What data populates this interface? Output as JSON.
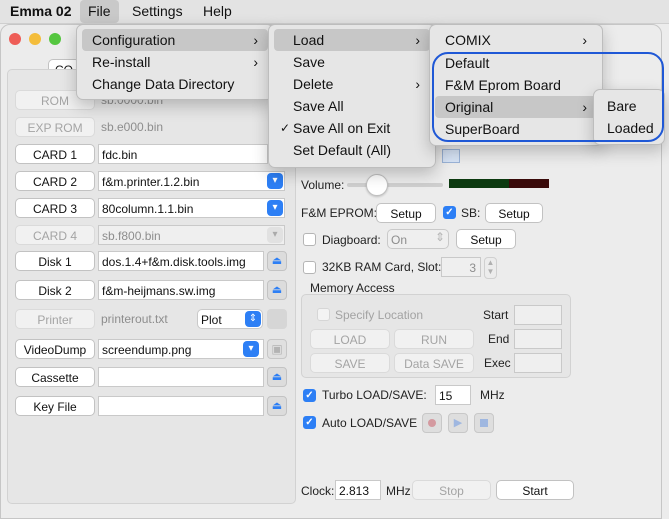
{
  "menubar": {
    "app": "Emma 02",
    "file": "File",
    "settings": "Settings",
    "help": "Help"
  },
  "file_menu": [
    {
      "label": "Configuration",
      "arrow": "›"
    },
    {
      "label": "Re-install",
      "arrow": "›"
    },
    {
      "label": "Change Data Directory"
    }
  ],
  "config_menu": [
    {
      "label": "Load",
      "arrow": "›"
    },
    {
      "label": "Save"
    },
    {
      "label": "Delete",
      "arrow": "›"
    },
    {
      "label": "Save All"
    },
    {
      "label": "Save All on Exit",
      "check": "✓"
    },
    {
      "label": "Set Default (All)"
    }
  ],
  "load_menu": [
    {
      "label": "COMIX",
      "arrow": "›"
    },
    {
      "label": "Default"
    },
    {
      "label": "F&M Eprom Board"
    },
    {
      "label": "Original",
      "arrow": "›"
    },
    {
      "label": "SuperBoard"
    }
  ],
  "original_menu": [
    {
      "label": "Bare"
    },
    {
      "label": "Loaded"
    }
  ],
  "window": {
    "tab_fragment": "CO",
    "rows": [
      {
        "button": "ROM",
        "value": "sb.0000.bin"
      },
      {
        "button": "EXP ROM",
        "value": "sb.e000.bin"
      },
      {
        "button": "CARD 1",
        "value": "fdc.bin"
      },
      {
        "button": "CARD 2",
        "value": "f&m.printer.1.2.bin"
      },
      {
        "button": "CARD 3",
        "value": "80column.1.1.bin"
      },
      {
        "button": "CARD 4",
        "value": "sb.f800.bin"
      },
      {
        "button": "Disk 1",
        "value": "dos.1.4+f&m.disk.tools.img"
      },
      {
        "button": "Disk 2",
        "value": "f&m-heijmans.sw.img"
      },
      {
        "button": "Printer",
        "value": "printerout.txt",
        "select": "Plot"
      },
      {
        "button": "VideoDump",
        "value": "screendump.png"
      },
      {
        "button": "Cassette",
        "value": ""
      },
      {
        "button": "Key File",
        "value": ""
      }
    ],
    "volume_label": "Volume:",
    "fm_eprom_label": "F&M EPROM:",
    "setup": "Setup",
    "sb_label": "SB:",
    "diagboard_label": "Diagboard:",
    "diagboard_value": "On",
    "ram_label": "32KB RAM Card, Slot:",
    "ram_slot": "3",
    "memory_access": "Memory Access",
    "specify_location": "Specify Location",
    "load": "LOAD",
    "run": "RUN",
    "save": "SAVE",
    "data_save": "Data SAVE",
    "start": "Start",
    "end": "End",
    "exec": "Exec",
    "turbo_label": "Turbo LOAD/SAVE:",
    "turbo_value": "15",
    "mhz": "MHz",
    "auto_label": "Auto LOAD/SAVE",
    "clock_label": "Clock:",
    "clock_value": "2.813",
    "clock_unit": "MHz",
    "stop": "Stop",
    "start_button": "Start"
  },
  "colors": {
    "accent": "#2d7ff5",
    "highlight_ring": "#1f58d6",
    "volume_meter": "#0c3a10",
    "volume_meter_peak": "#3a0a0a"
  }
}
